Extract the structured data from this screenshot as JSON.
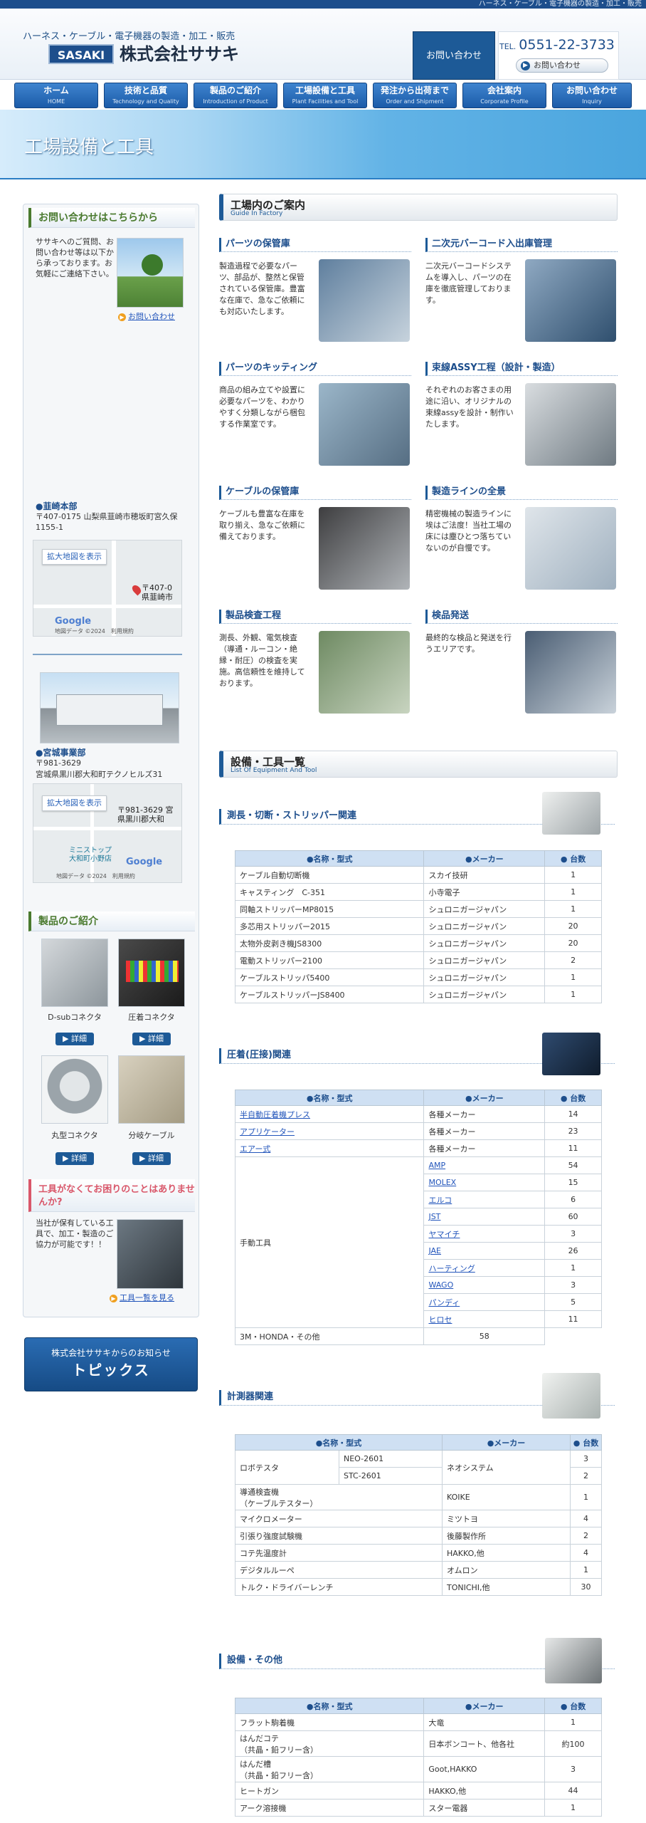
{
  "topstrip": "ハーネス・ケーブル・電子機器の製造・加工・販売",
  "header": {
    "tagline": "ハーネス・ケーブル・電子機器の製造・加工・販売",
    "logo": "SASAKI",
    "company": "株式会社ササキ",
    "contact_button": "お問い合わせ",
    "tel_prefix": "TEL.",
    "tel": "0551-22-3733",
    "tel_link": "お問い合わせ"
  },
  "nav": [
    {
      "ja": "ホーム",
      "en": "HOME"
    },
    {
      "ja": "技術と品質",
      "en": "Technology and Quality"
    },
    {
      "ja": "製品のご紹介",
      "en": "Introduction of Product"
    },
    {
      "ja": "工場設備と工具",
      "en": "Plant Facilities and Tool"
    },
    {
      "ja": "発注から出荷まで",
      "en": "Order and Shipment"
    },
    {
      "ja": "会社案内",
      "en": "Corporate Profile"
    },
    {
      "ja": "お問い合わせ",
      "en": "Inquiry"
    }
  ],
  "banner": {
    "title": "工場設備と工具"
  },
  "sidebar": {
    "contact": {
      "title": "お問い合わせはこちらから",
      "text": "ササキへのご質問、お問い合わせ等は以下から承っております。お気軽にご連絡下さい。",
      "link": "お問い合わせ"
    },
    "office1": {
      "name": "●韮崎本部",
      "addr": "〒407-0175 山梨県韮崎市穂坂町宮久保1155-1",
      "map_button": "拡大地図を表示",
      "map_label": "〒407-0\n県韮崎市",
      "map_credit": "地図データ ©2024　利用規約"
    },
    "office2": {
      "name": "●宮城事業部",
      "postal": "〒981-3629",
      "addr": "宮城県黒川郡大和町テクノヒルズ31",
      "map_button": "拡大地図を表示",
      "map_label": "〒981-3629 宮\n県黒川郡大和",
      "map_place": "ミニストップ\n大和町小野店",
      "map_credit": "地図データ ©2024　利用規約"
    },
    "products": {
      "title": "製品のご紹介",
      "items": [
        "D-subコネクタ",
        "圧着コネクタ",
        "丸型コネクタ",
        "分岐ケーブル"
      ],
      "detail": "詳細"
    },
    "tools": {
      "title": "工具がなくてお困りのことはありませんか?",
      "text": "当社が保有している工具で、加工・製造のご協力が可能です！！",
      "link": "工具一覧を見る"
    },
    "topics": {
      "line1": "株式会社ササキからのお知らせ",
      "line2": "トピックス"
    }
  },
  "guide": {
    "title": "工場内のご案内",
    "subtitle": "Guide In Factory",
    "items": [
      {
        "title": "パーツの保管庫",
        "text": "製造過程で必要なパーツ、部品が、整然と保管されている保管庫。豊富な在庫で、急なご依頼にも対応いたします。"
      },
      {
        "title": "二次元バーコード入出庫管理",
        "text": "二次元バーコードシステムを導入し、パーツの在庫を徹底管理しております。"
      },
      {
        "title": "パーツのキッティング",
        "text": "商品の組み立てや設置に必要なパーツを、わかりやすく分類しながら梱包する作業室です。"
      },
      {
        "title": "束線ASSY工程（設計・製造）",
        "text": "それぞれのお客さまの用途に沿い、オリジナルの束線assyを設計・制作いたします。"
      },
      {
        "title": "ケーブルの保管庫",
        "text": "ケーブルも豊富な在庫を取り揃え、急なご依頼に備えております。"
      },
      {
        "title": "製造ラインの全景",
        "text": "精密機械の製造ラインに埃はご法度！当社工場の床には塵ひとつ落ちていないのが自慢です。"
      },
      {
        "title": "製品検査工程",
        "text": "測長、外観、電気検査（導通・ルーコン・絶縁・耐圧）の検査を実施。高信頼性を維持しております。"
      },
      {
        "title": "検品発送",
        "text": "最終的な検品と発送を行うエリアです。"
      }
    ]
  },
  "equipment": {
    "title": "設備・工具一覧",
    "subtitle": "List Of Equipment And Tool",
    "headers": [
      "●名称・型式",
      "●メーカー",
      "● 台数"
    ],
    "cat1": {
      "title": "測長・切断・ストリッパー関連",
      "rows": [
        [
          "ケーブル自動切断機",
          "スカイ技研",
          "1"
        ],
        [
          "キャスティング　C-351",
          "小寺電子",
          "1"
        ],
        [
          "同軸ストリッパーMP8015",
          "シュロニガージャパン",
          "1"
        ],
        [
          "多芯用ストリッパー2015",
          "シュロニガージャパン",
          "20"
        ],
        [
          "太物外皮剥き機JS8300",
          "シュロニガージャパン",
          "20"
        ],
        [
          "電動ストリッパー2100",
          "シュロニガージャパン",
          "2"
        ],
        [
          "ケーブルストリッパ5400",
          "シュロニガージャパン",
          "1"
        ],
        [
          "ケーブルストリッパーJS8400",
          "シュロニガージャパン",
          "1"
        ]
      ]
    },
    "cat2": {
      "title": "圧着(圧接)関連",
      "rows_top": [
        [
          "半自動圧着機プレス",
          "各種メーカー",
          "14"
        ],
        [
          "アプリケーター",
          "各種メーカー",
          "23"
        ],
        [
          "エアー式",
          "各種メーカー",
          "11"
        ]
      ],
      "hand_tools": "手動工具",
      "hand_rows": [
        [
          "AMP",
          "54"
        ],
        [
          "MOLEX",
          "15"
        ],
        [
          "エルコ",
          "6"
        ],
        [
          "JST",
          "60"
        ],
        [
          "ヤマイチ",
          "3"
        ],
        [
          "JAE",
          "26"
        ],
        [
          "ハーティング",
          "1"
        ],
        [
          "WAGO",
          "3"
        ],
        [
          "パンディ",
          "5"
        ],
        [
          "ヒロセ",
          "11"
        ]
      ],
      "last": [
        "3M・HONDA・その他",
        "58"
      ]
    },
    "cat3": {
      "title": "計測器関連",
      "robo": "ロボテスタ",
      "robo_rows": [
        [
          "NEO-2601",
          "3"
        ],
        [
          "STC-2601",
          "2"
        ]
      ],
      "robo_maker": "ネオシステム",
      "rows": [
        [
          "導通検査機\n（ケーブルテスター）",
          "KOIKE",
          "1"
        ],
        [
          "マイクロメーター",
          "ミツトヨ",
          "4"
        ],
        [
          "引張り強度試験機",
          "後藤製作所",
          "2"
        ],
        [
          "コテ先温度計",
          "HAKKO,他",
          "4"
        ],
        [
          "デジタルルーペ",
          "オムロン",
          "1"
        ],
        [
          "トルク・ドライバーレンチ",
          "TONICHI,他",
          "30"
        ]
      ]
    },
    "cat4": {
      "title": "設備・その他",
      "rows": [
        [
          "フラット駒着機",
          "大竜",
          "1"
        ],
        [
          "はんだコテ\n（共晶・鉛フリー含）",
          "日本ボンコート、他各社",
          "約100"
        ],
        [
          "はんだ槽\n（共晶・鉛フリー含）",
          "Goot,HAKKO",
          "3"
        ],
        [
          "ヒートガン",
          "HAKKO,他",
          "44"
        ],
        [
          "アーク溶接機",
          "スター電器",
          "1"
        ]
      ]
    }
  }
}
